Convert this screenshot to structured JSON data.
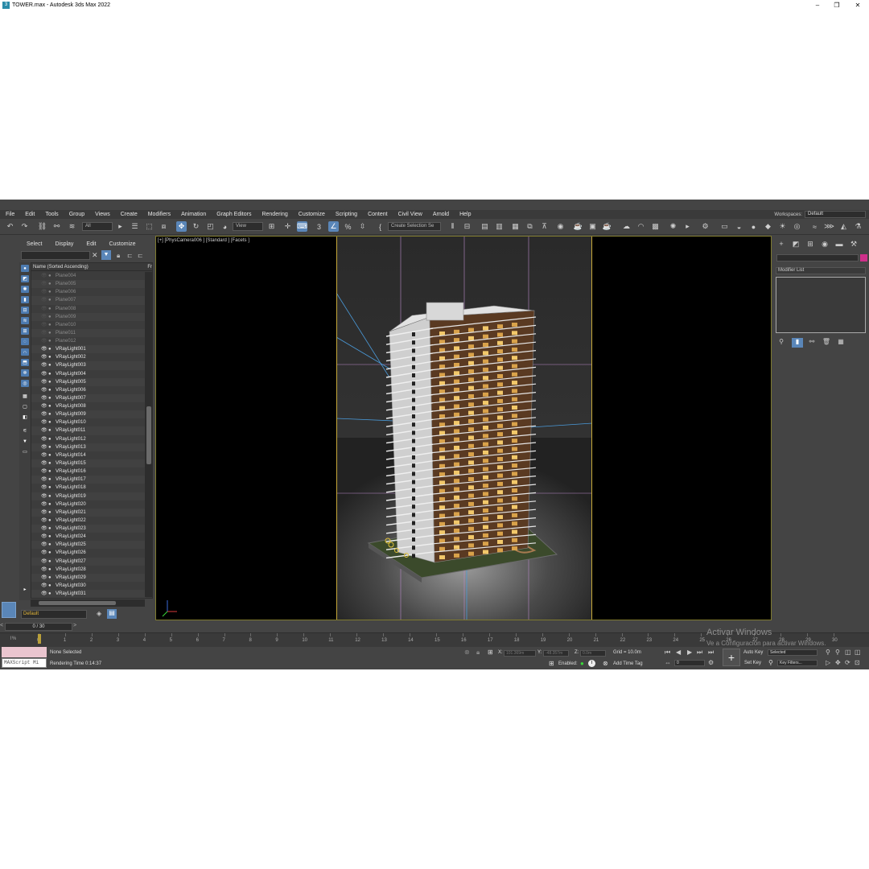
{
  "window": {
    "title": "TOWER.max - Autodesk 3ds Max 2022",
    "minimize": "–",
    "maximize": "❐",
    "close": "✕"
  },
  "menu": [
    "File",
    "Edit",
    "Tools",
    "Group",
    "Views",
    "Create",
    "Modifiers",
    "Animation",
    "Graph Editors",
    "Rendering",
    "Customize",
    "Scripting",
    "Content",
    "Civil View",
    "Arnold",
    "Help"
  ],
  "workspace": {
    "label": "Workspaces:",
    "value": "Default"
  },
  "toolbar": {
    "filter": "All",
    "refcoord": "View",
    "selection_set": "Create Selection Se"
  },
  "explorer": {
    "tabs": [
      "Select",
      "Display",
      "Edit",
      "Customize"
    ],
    "header": "Name (Sorted Ascending)",
    "header_right": "Fr",
    "hidden_items": [
      "Plane004",
      "Plane005",
      "Plane006",
      "Plane007",
      "Plane008",
      "Plane009",
      "Plane010",
      "Plane011",
      "Plane012"
    ],
    "light_items": [
      "VRayLight001",
      "VRayLight002",
      "VRayLight003",
      "VRayLight004",
      "VRayLight005",
      "VRayLight006",
      "VRayLight007",
      "VRayLight008",
      "VRayLight009",
      "VRayLight010",
      "VRayLight011",
      "VRayLight012",
      "VRayLight013",
      "VRayLight014",
      "VRayLight015",
      "VRayLight016",
      "VRayLight017",
      "VRayLight018",
      "VRayLight019",
      "VRayLight020",
      "VRayLight021",
      "VRayLight022",
      "VRayLight023",
      "VRayLight024",
      "VRayLight025",
      "VRayLight026",
      "VRayLight027",
      "VRayLight028",
      "VRayLight029",
      "VRayLight030",
      "VRayLight031"
    ],
    "layer": "Default"
  },
  "viewport": {
    "label": "[+] [PhysCamera006 ] [Standard ] [Facets ]"
  },
  "command_panel": {
    "modifier_list": "Modifier List"
  },
  "timeline": {
    "frame_counter": "0 / 30",
    "ticks": [
      "0",
      "1",
      "2",
      "3",
      "4",
      "5",
      "6",
      "7",
      "8",
      "9",
      "10",
      "11",
      "12",
      "13",
      "14",
      "15",
      "16",
      "17",
      "18",
      "19",
      "20",
      "21",
      "22",
      "23",
      "24",
      "25",
      "26",
      "27",
      "28",
      "29",
      "30"
    ]
  },
  "status": {
    "selection": "None Selected",
    "render_time": "Rendering Time  0:14:37",
    "maxscript": "MAXScript Mi",
    "x_label": "X:",
    "x_value": "101.369m",
    "y_label": "Y:",
    "y_value": "-48.357m",
    "z_label": "Z:",
    "z_value": "0.0m",
    "grid": "Grid = 10.0m",
    "enabled": "Enabled:",
    "add_time_tag": "Add Time Tag",
    "auto_key": "Auto Key",
    "set_key": "Set Key",
    "selected": "Selected",
    "key_filters": "Key Filters...",
    "frame_value": "0"
  },
  "watermark": {
    "line1": "Activar Windows",
    "line2": "Ve a Configuración para activar Windows."
  },
  "colors": {
    "accent": "#5a86b8",
    "viewport_border": "#7f7a2e",
    "layer_text": "#e7b93a"
  }
}
